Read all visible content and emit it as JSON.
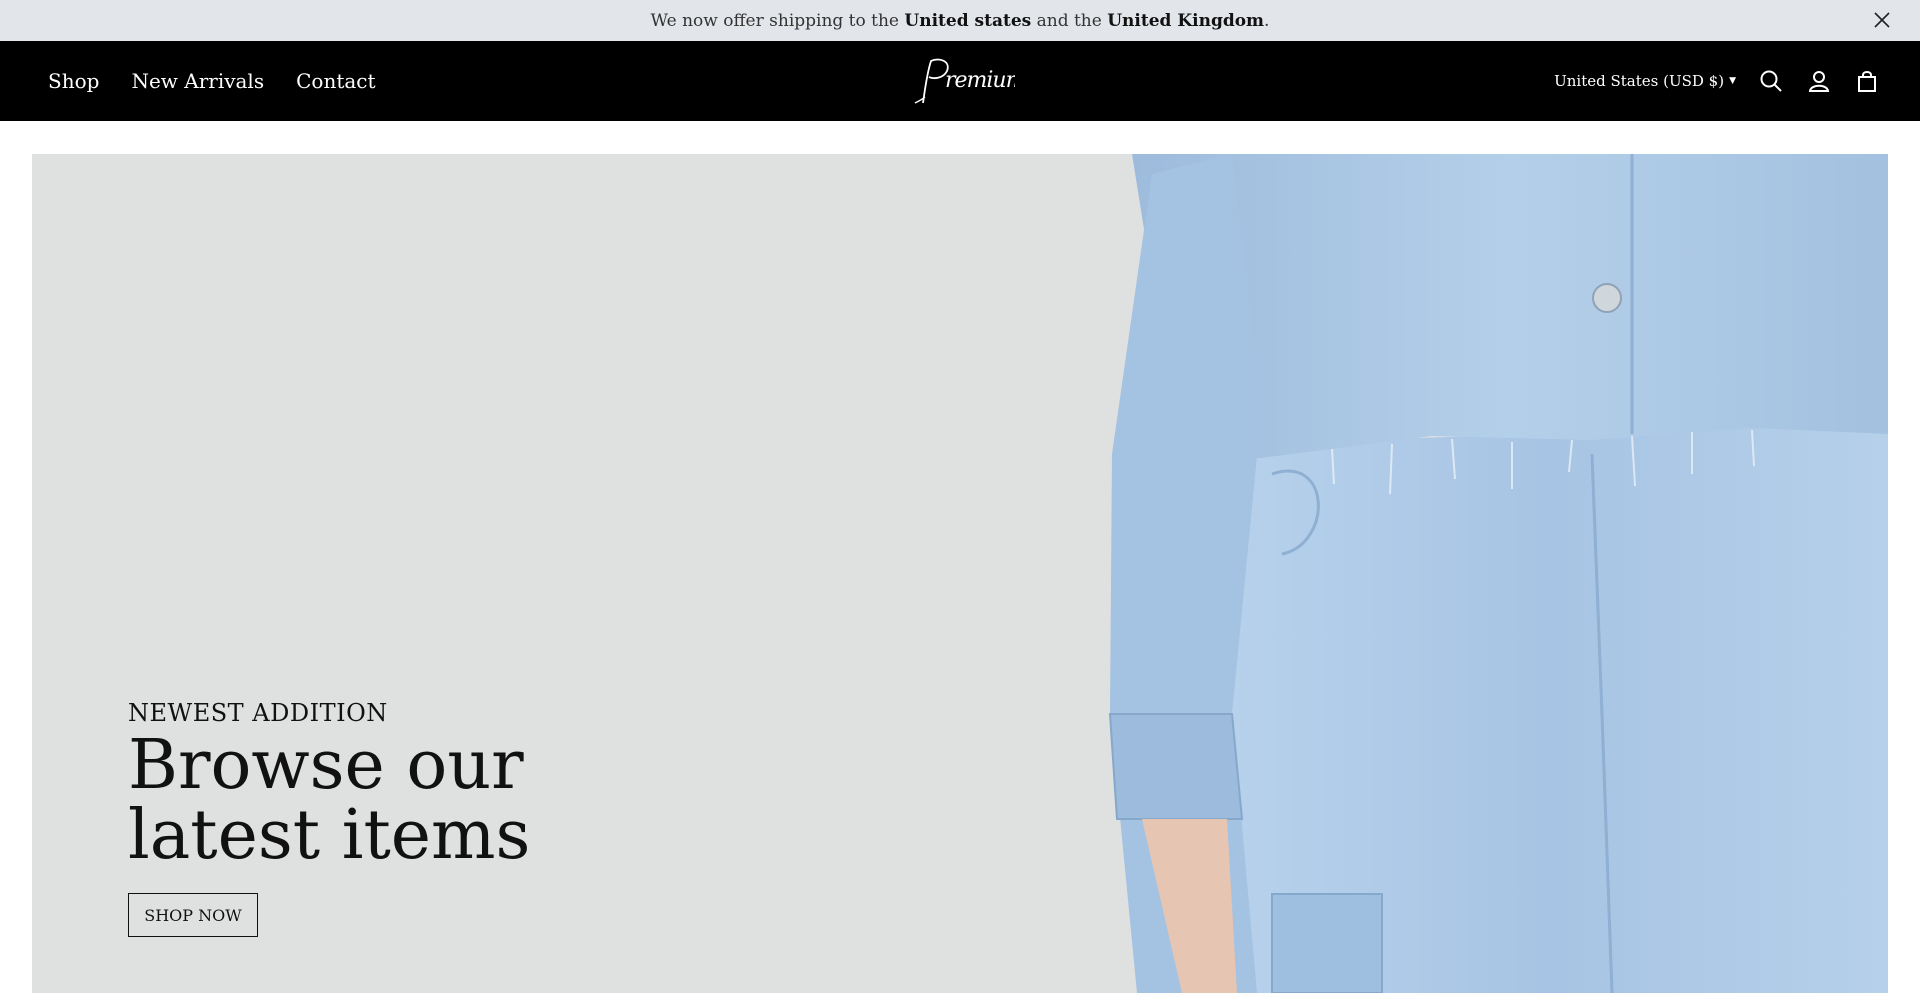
{
  "announcement": {
    "prefix": "We now offer shipping to the ",
    "country1": "United states",
    "middle": " and the ",
    "country2": "United Kingdom",
    "suffix": ".",
    "close_icon": "close-icon"
  },
  "header": {
    "nav": [
      {
        "label": "Shop"
      },
      {
        "label": "New Arrivals"
      },
      {
        "label": "Contact"
      }
    ],
    "logo_text": "Premium",
    "currency": "United States (USD $)",
    "icons": [
      "search-icon",
      "account-icon",
      "cart-icon"
    ]
  },
  "hero": {
    "eyebrow": "NEWEST ADDITION",
    "headline": "Browse our latest items",
    "cta_label": "SHOP NOW"
  },
  "colors": {
    "announcement_bg": "#e2e6ea",
    "header_bg": "#000000",
    "hero_bg": "#dfe0e0",
    "denim": "#a9c6e3"
  }
}
